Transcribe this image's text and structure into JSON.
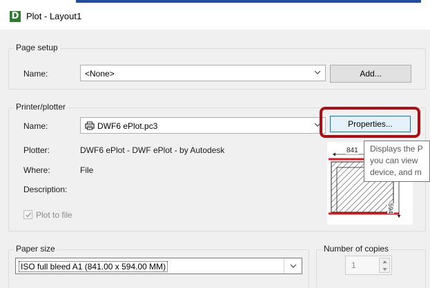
{
  "window": {
    "title": "Plot - Layout1",
    "app_icon_letter": "D"
  },
  "page_setup": {
    "group_label": "Page setup",
    "name_label": "Name:",
    "name_value": "<None>",
    "add_button": "Add..."
  },
  "printer": {
    "group_label": "Printer/plotter",
    "name_label": "Name:",
    "name_value": "DWF6 ePlot.pc3",
    "properties_button": "Properties...",
    "plotter_label": "Plotter:",
    "plotter_value": "DWF6 ePlot - DWF ePlot - by Autodesk",
    "where_label": "Where:",
    "where_value": "File",
    "description_label": "Description:",
    "plot_to_file_label": "Plot to file",
    "plot_to_file_checked": true,
    "tooltip_lines": [
      "Displays the P",
      "you can view",
      "device, and m"
    ],
    "preview_width_label": "841",
    "preview_height_label": "594"
  },
  "paper_size": {
    "group_label": "Paper size",
    "value": "ISO full bleed A1 (841.00 x 594.00 MM)"
  },
  "copies": {
    "group_label": "Number of copies",
    "value": "1"
  },
  "colors": {
    "highlight": "#b00d12",
    "preview_marker": "#e0141c",
    "app_icon": "#2e7d32"
  }
}
